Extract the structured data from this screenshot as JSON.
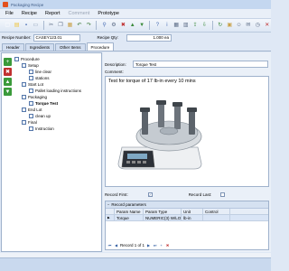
{
  "window": {
    "title": "Packaging Recipe"
  },
  "menu": [
    {
      "label": "File",
      "enabled": true
    },
    {
      "label": "Recipe",
      "enabled": true
    },
    {
      "label": "Report",
      "enabled": true
    },
    {
      "label": "Comment",
      "enabled": false
    },
    {
      "label": "Prototype",
      "enabled": true
    }
  ],
  "toolbar": [
    {
      "icon": "new-icon",
      "glyph": "▢",
      "color": "#ffffff"
    },
    {
      "icon": "open-icon",
      "glyph": "▤",
      "color": "#f0c53a"
    },
    {
      "icon": "save-icon",
      "glyph": "▪",
      "color": "#4a6fb5"
    },
    {
      "icon": "print-icon",
      "glyph": "▭",
      "color": "#8a9bb5"
    },
    {
      "icon": "cut-icon",
      "glyph": "✂",
      "color": "#5a6b85"
    },
    {
      "icon": "copy-icon",
      "glyph": "❐",
      "color": "#5a6b85"
    },
    {
      "icon": "paste-icon",
      "glyph": "▦",
      "color": "#c9a24a"
    },
    {
      "icon": "undo-icon",
      "glyph": "↶",
      "color": "#3a7a3a"
    },
    {
      "icon": "redo-icon",
      "glyph": "↷",
      "color": "#3a7a3a"
    },
    {
      "icon": "search-icon",
      "glyph": "⚲",
      "color": "#4a6fb5"
    },
    {
      "icon": "settings-icon",
      "glyph": "⚙",
      "color": "#5a6b85"
    },
    {
      "icon": "delete-icon",
      "glyph": "✖",
      "color": "#c03030"
    },
    {
      "icon": "up-icon",
      "glyph": "▲",
      "color": "#3a8a3a"
    },
    {
      "icon": "down-icon",
      "glyph": "▼",
      "color": "#3a8a3a"
    },
    {
      "icon": "help-icon",
      "glyph": "?",
      "color": "#4a6fb5"
    },
    {
      "icon": "info-icon",
      "glyph": "i",
      "color": "#4a6fb5"
    },
    {
      "icon": "grid-icon",
      "glyph": "▦",
      "color": "#5a6b85"
    },
    {
      "icon": "chart-icon",
      "glyph": "▥",
      "color": "#5a6b85"
    },
    {
      "icon": "export-icon",
      "glyph": "⇪",
      "color": "#3a8a3a"
    },
    {
      "icon": "import-icon",
      "glyph": "⇩",
      "color": "#3a8a3a"
    },
    {
      "icon": "refresh-icon",
      "glyph": "↻",
      "color": "#3a8a3a"
    },
    {
      "icon": "lock-icon",
      "glyph": "▣",
      "color": "#c9a24a"
    },
    {
      "icon": "user-icon",
      "glyph": "☺",
      "color": "#5a6b85"
    },
    {
      "icon": "mail-icon",
      "glyph": "✉",
      "color": "#5a6b85"
    },
    {
      "icon": "clock-icon",
      "glyph": "◷",
      "color": "#5a6b85"
    },
    {
      "icon": "close-icon",
      "glyph": "✕",
      "color": "#c03030"
    }
  ],
  "recipe": {
    "number_label": "Recipe Number:",
    "number_value": "CASEY123.01",
    "qty_label": "Recipe Qty:",
    "qty_value": "1.000 ea"
  },
  "tabs": [
    {
      "label": "Header",
      "active": false
    },
    {
      "label": "Ingredients",
      "active": false
    },
    {
      "label": "Other Items",
      "active": false
    },
    {
      "label": "Procedure",
      "active": true
    }
  ],
  "tree_tools": [
    {
      "icon": "add-icon",
      "glyph": "+",
      "color": "#3a9a3a"
    },
    {
      "icon": "delete-icon",
      "glyph": "✖",
      "color": "#c03030"
    },
    {
      "icon": "move-up-icon",
      "glyph": "▲",
      "color": "#3a9a3a"
    },
    {
      "icon": "move-down-icon",
      "glyph": "▼",
      "color": "#3a9a3a"
    }
  ],
  "tree": [
    {
      "label": "Procedure",
      "level": 0,
      "bold": false
    },
    {
      "label": "Setup",
      "level": 1,
      "bold": false
    },
    {
      "label": "line clear",
      "level": 2,
      "bold": false
    },
    {
      "label": "stations",
      "level": 2,
      "bold": false
    },
    {
      "label": "Start Lot",
      "level": 1,
      "bold": false
    },
    {
      "label": "Pallet loading instructions",
      "level": 2,
      "bold": false
    },
    {
      "label": "Packaging",
      "level": 1,
      "bold": false
    },
    {
      "label": "Torque Test",
      "level": 2,
      "bold": true
    },
    {
      "label": "End Lot",
      "level": 1,
      "bold": false
    },
    {
      "label": "clean up",
      "level": 2,
      "bold": false
    },
    {
      "label": "Final",
      "level": 1,
      "bold": false
    },
    {
      "label": "Instruction",
      "level": 2,
      "bold": false
    }
  ],
  "detail": {
    "description_label": "Description:",
    "description_value": "Torque Test",
    "comment_label": "Comment:",
    "comment_text": "Test for torque of 17 lb-in every 10 mins",
    "record_first_label": "Record First:",
    "record_first_checked": true,
    "record_last_label": "Record Last:",
    "record_last_checked": false
  },
  "params": {
    "title": "Record parameters",
    "columns": [
      "Param Name",
      "Param Type",
      "Unit",
      "Control"
    ],
    "rows": [
      [
        "Torque",
        "NUMERIC(3) W/LO...",
        "lb-in",
        ""
      ]
    ],
    "nav_text": "Record 1 of 1"
  }
}
